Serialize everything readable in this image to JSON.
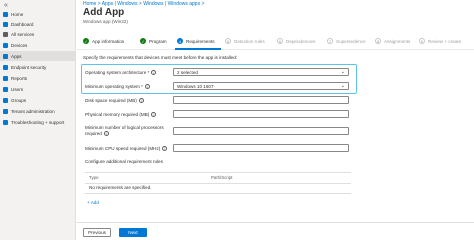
{
  "sidebar": {
    "collapse_glyph": "«",
    "items": [
      {
        "label": "Home",
        "icon": "home-icon",
        "color": "#0078d4"
      },
      {
        "label": "Dashboard",
        "icon": "dashboard-icon",
        "color": "#0078d4"
      },
      {
        "label": "All services",
        "icon": "all-services-icon",
        "color": "#605e5c"
      },
      {
        "label": "Devices",
        "icon": "devices-icon",
        "color": "#0078d4"
      },
      {
        "label": "Apps",
        "icon": "apps-icon",
        "color": "#0078d4"
      },
      {
        "label": "Endpoint security",
        "icon": "endpoint-security-icon",
        "color": "#0078d4"
      },
      {
        "label": "Reports",
        "icon": "reports-icon",
        "color": "#0078d4"
      },
      {
        "label": "Users",
        "icon": "users-icon",
        "color": "#0078d4"
      },
      {
        "label": "Groups",
        "icon": "groups-icon",
        "color": "#0078d4"
      },
      {
        "label": "Tenant administration",
        "icon": "tenant-admin-icon",
        "color": "#0078d4"
      },
      {
        "label": "Troubleshooting + support",
        "icon": "troubleshooting-icon",
        "color": "#0078d4"
      }
    ],
    "active_index": 4
  },
  "header": {
    "breadcrumb": "Home > Apps | Windows > Windows | Windows apps >",
    "title": "Add App",
    "subtitle": "Windows app (Win32)"
  },
  "steps": [
    {
      "label": "App information",
      "state": "done",
      "marker": "✓"
    },
    {
      "label": "Program",
      "state": "done",
      "marker": "✓"
    },
    {
      "label": "Requirements",
      "state": "current",
      "marker": "4"
    },
    {
      "label": "Detection rules",
      "state": "todo",
      "marker": "5"
    },
    {
      "label": "Dependencies",
      "state": "todo",
      "marker": "6"
    },
    {
      "label": "Supersedence",
      "state": "todo",
      "marker": "7"
    },
    {
      "label": "Assignments",
      "state": "todo",
      "marker": "8"
    },
    {
      "label": "Review + create",
      "state": "todo",
      "marker": "9"
    }
  ],
  "form": {
    "intro": "Specify the requirements that devices must meet before the app is installed:",
    "os_arch_label": "Operating system architecture *",
    "os_arch_value": "2 selected",
    "min_os_label": "Minimum operating system *",
    "min_os_value": "Windows 10 1607",
    "disk_label": "Disk space required (MB)",
    "memory_label": "Physical memory required (MB)",
    "cpu_count_label_1": "Minimum number of logical processors",
    "cpu_count_label_2": "required",
    "cpu_speed_label": "Minimum CPU speed required (MHz)",
    "additional_label": "Configure additional requirement rules",
    "info_glyph": "i",
    "dropdown_glyph": "⌄"
  },
  "rules_table": {
    "columns": [
      "Type",
      "Path/Script"
    ],
    "empty_text": "No requirements are specified.",
    "add_link": "+ Add"
  },
  "footer": {
    "previous_label": "Previous",
    "next_label": "Next"
  },
  "colors": {
    "accent": "#0078d4",
    "success": "#107c10",
    "highlight_border": "#5bc4e8"
  }
}
